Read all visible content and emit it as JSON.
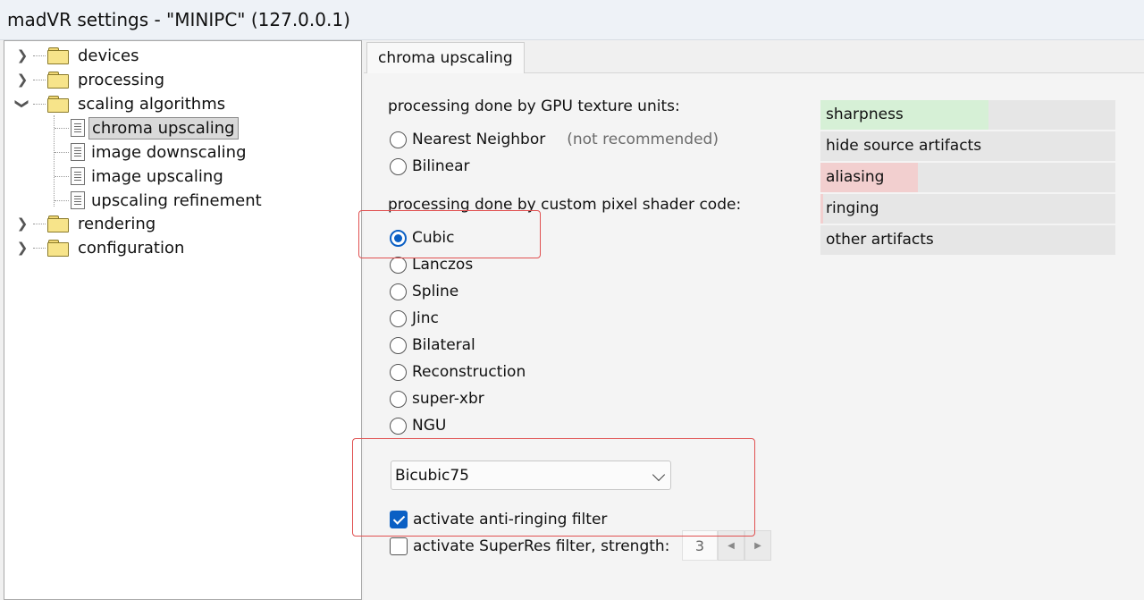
{
  "window": {
    "title": "madVR settings - \"MINIPC\" (127.0.0.1)"
  },
  "tree": {
    "devices": "devices",
    "processing": "processing",
    "scaling_algorithms": "scaling algorithms",
    "chroma_upscaling": "chroma upscaling",
    "image_downscaling": "image downscaling",
    "image_upscaling": "image upscaling",
    "upscaling_refinement": "upscaling refinement",
    "rendering": "rendering",
    "configuration": "configuration"
  },
  "tab": {
    "label": "chroma upscaling"
  },
  "gpu_section": {
    "label": "processing done by GPU texture units:",
    "nearest": "Nearest Neighbor",
    "nearest_note": "(not recommended)",
    "bilinear": "Bilinear"
  },
  "shader_section": {
    "label": "processing done by custom pixel shader code:",
    "options": [
      "Cubic",
      "Lanczos",
      "Spline",
      "Jinc",
      "Bilateral",
      "Reconstruction",
      "super-xbr",
      "NGU"
    ],
    "selected": "Cubic"
  },
  "filter_dropdown": {
    "value": "Bicubic75"
  },
  "anti_ringing": {
    "label": "activate anti-ringing filter",
    "checked": true
  },
  "superres": {
    "label": "activate SuperRes filter, strength:",
    "checked": false,
    "strength": "3"
  },
  "quality_bars": [
    {
      "label": "sharpness",
      "fill": 0.57,
      "color": "#d6f0d6"
    },
    {
      "label": "hide source artifacts",
      "fill": 0,
      "color": "#d6f0d6"
    },
    {
      "label": "aliasing",
      "fill": 0.33,
      "color": "#f2cfcf"
    },
    {
      "label": "ringing",
      "fill": 0.01,
      "color": "#f2cfcf"
    },
    {
      "label": "other artifacts",
      "fill": 0,
      "color": "#f2cfcf"
    }
  ],
  "colors": {
    "accent": "#0a5fc4",
    "highlight_box": "#e05050"
  }
}
